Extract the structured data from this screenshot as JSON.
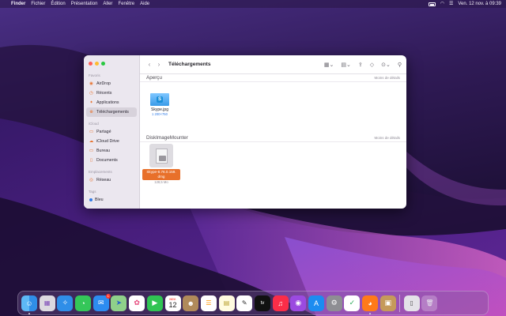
{
  "menubar": {
    "items": [
      "Finder",
      "Fichier",
      "Édition",
      "Présentation",
      "Aller",
      "Fenêtre",
      "Aide"
    ],
    "clock": "Ven. 12 nov. à 09:39"
  },
  "finder": {
    "title": "Téléchargements",
    "sidebar": {
      "favoris_label": "Favoris",
      "favoris": [
        "AirDrop",
        "Récents",
        "Applications",
        "Téléchargements"
      ],
      "icloud_label": "iCloud",
      "icloud": [
        "Partagé",
        "iCloud Drive",
        "Bureau",
        "Documents"
      ],
      "emplacements_label": "Emplacements",
      "emplacements": [
        "Réseau"
      ],
      "tags_label": "Tags",
      "tags": [
        "Bleu"
      ]
    },
    "sections": [
      {
        "title": "Aperçu",
        "more": "Moins de détails",
        "file": {
          "name": "Skype.jpg",
          "sub": "1 200×750"
        }
      },
      {
        "title": "DiskImageMounter",
        "more": "Moins de détails",
        "file": {
          "name_line1": "Skype-8.76.0.159.",
          "name_line2": "dmg",
          "sub": "128,5 Mo"
        }
      }
    ]
  },
  "dock": {
    "calendar_month": "NOV.",
    "calendar_day": "12",
    "mail_badge": "1",
    "apps": [
      "Finder",
      "Launchpad",
      "Safari",
      "Messages",
      "Mail",
      "Plans",
      "Photos",
      "FaceTime",
      "Calendrier",
      "Contacts",
      "Rappels",
      "Notes",
      "Freeform",
      "TV",
      "Musique",
      "Podcasts",
      "App Store",
      "Réglages Système",
      "Antidote",
      "Firefox",
      "Archives",
      "Aperçu",
      "Corbeille"
    ]
  }
}
